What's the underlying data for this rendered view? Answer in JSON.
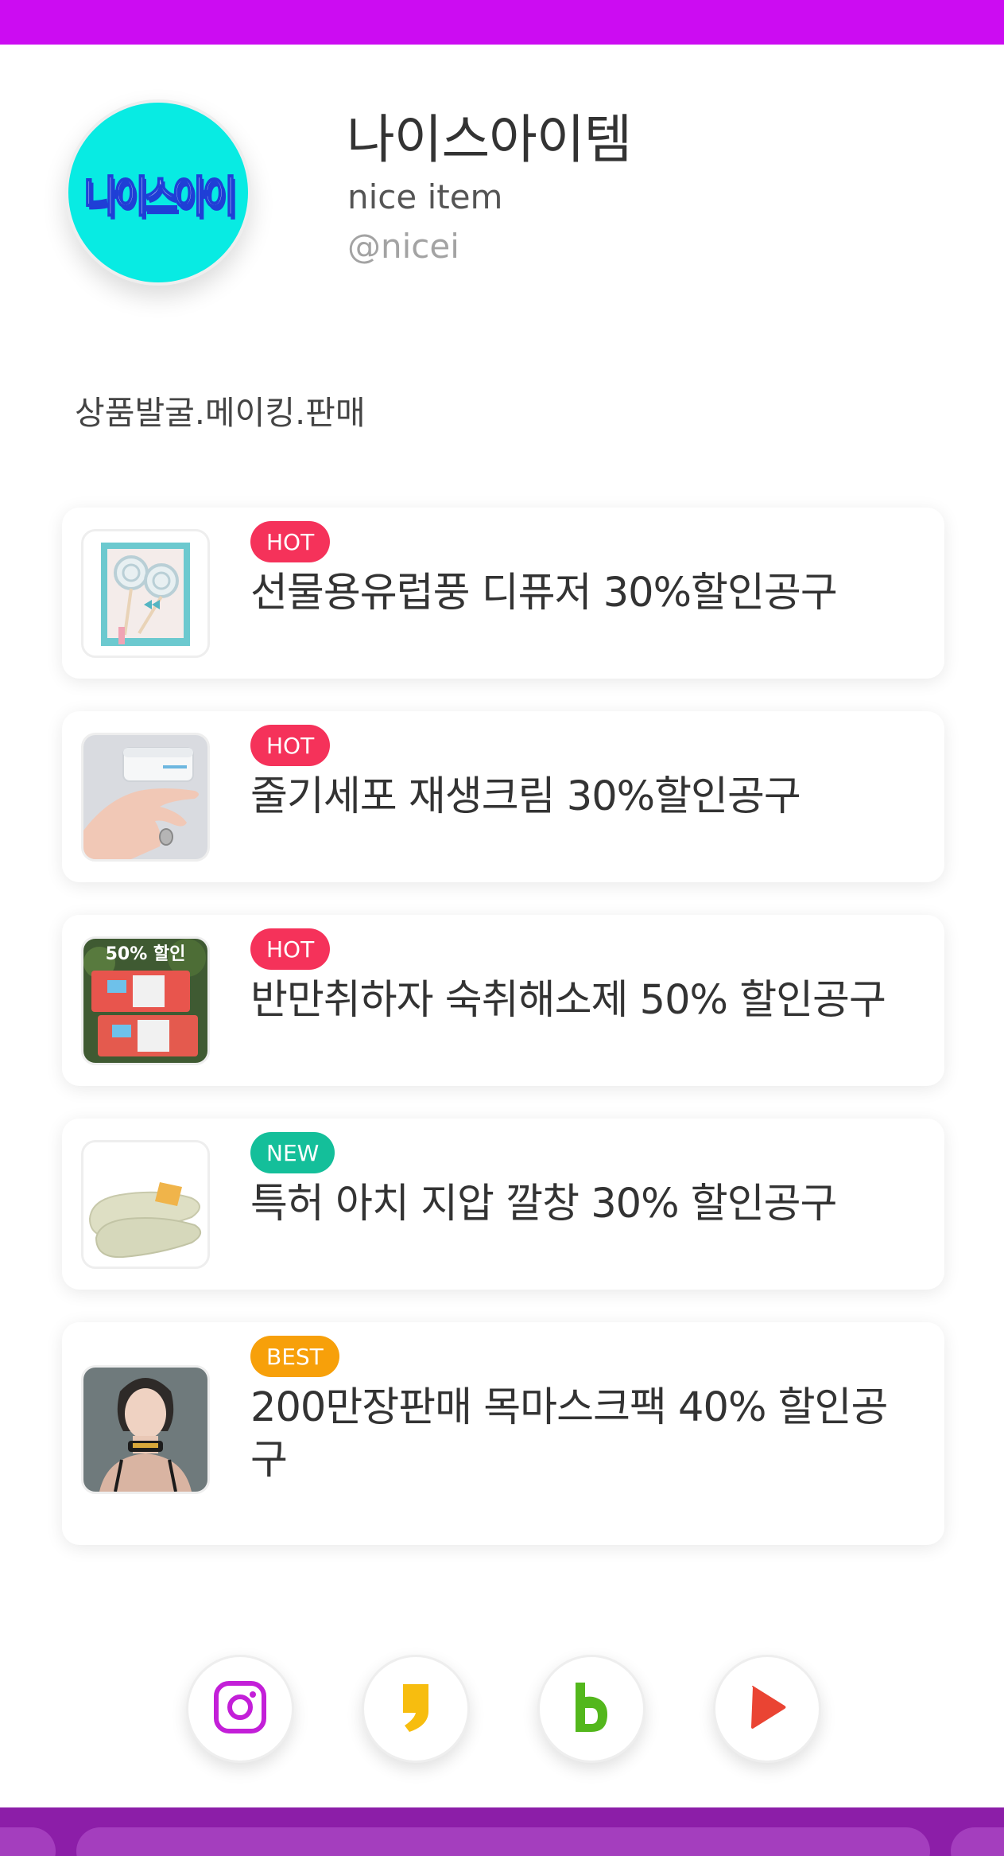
{
  "colors": {
    "accent": "#cc0cf2",
    "footer": "#8c1ea8",
    "hot_badge": "#f5325a",
    "new_badge": "#14bf9a",
    "best_badge": "#f7a00a",
    "avatar_bg": "#08ebe3"
  },
  "profile": {
    "avatar_logo_text": "나이스아이",
    "name": "나이스아이템",
    "subtitle": "nice item",
    "handle": "@nicei",
    "bio": "상품발굴.메이킹.판매"
  },
  "links": [
    {
      "badge": "HOT",
      "badge_type": "hot",
      "title": "선물용유럽풍 디퓨저 30%할인공구",
      "thumbnail": "lollipop-diffuser-image"
    },
    {
      "badge": "HOT",
      "badge_type": "hot",
      "title": "줄기세포 재생크림 30%할인공구",
      "thumbnail": "cream-jar-hand-image"
    },
    {
      "badge": "HOT",
      "badge_type": "hot",
      "title": "반만취하자 숙취해소제 50% 할인공구",
      "thumbnail": "hangover-remedy-box-image"
    },
    {
      "badge": "NEW",
      "badge_type": "new",
      "title": "특허 아치 지압 깔창 30% 할인공구",
      "thumbnail": "insoles-image"
    },
    {
      "badge": "BEST",
      "badge_type": "best",
      "title": "200만장판매 목마스크팩 40% 할인공구",
      "thumbnail": "neck-mask-model-image"
    }
  ],
  "social": [
    {
      "name": "instagram",
      "icon": "instagram-icon"
    },
    {
      "name": "kakao",
      "icon": "kakao-channel-icon"
    },
    {
      "name": "band",
      "icon": "band-icon"
    },
    {
      "name": "youtube",
      "icon": "play-icon"
    }
  ]
}
